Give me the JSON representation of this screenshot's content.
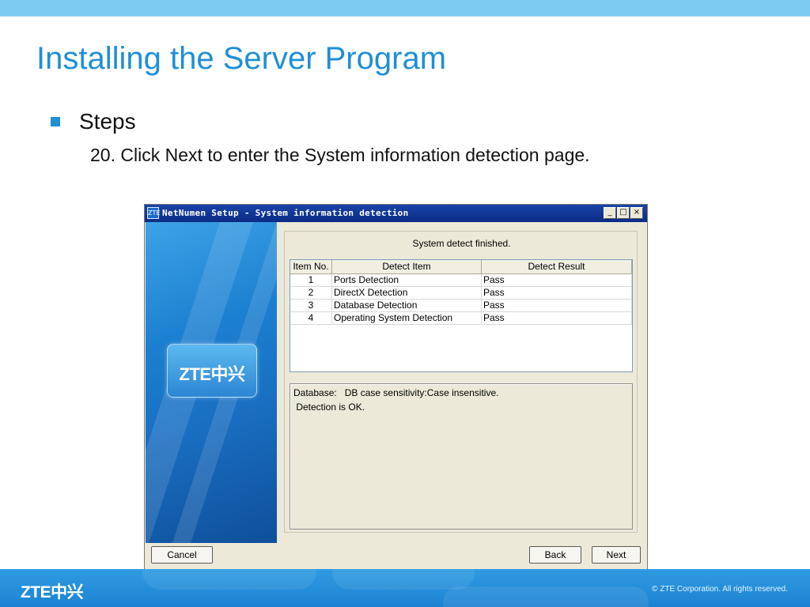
{
  "slide": {
    "title": "Installing the Server Program",
    "bullet": "Steps",
    "step": "20. Click Next to enter the System information detection page."
  },
  "window": {
    "title": "NetNumen Setup - System information detection",
    "icon_label": "ZTE",
    "controls": {
      "minimize": "_",
      "maximize": "□",
      "close": "×"
    },
    "logo_text": "ZTE中兴",
    "status": "System detect finished.",
    "table": {
      "columns": [
        "Item No.",
        "Detect Item",
        "Detect Result"
      ],
      "rows": [
        [
          "1",
          "Ports Detection",
          "Pass"
        ],
        [
          "2",
          "DirectX Detection",
          "Pass"
        ],
        [
          "3",
          "Database Detection",
          "Pass"
        ],
        [
          "4",
          "Operating System Detection",
          "Pass"
        ]
      ]
    },
    "info": {
      "line1": "Database:   DB case sensitivity:Case insensitive.",
      "line2": " Detection is OK."
    },
    "buttons": {
      "cancel": "Cancel",
      "back": "Back",
      "next": "Next"
    }
  },
  "footer": {
    "logo": "ZTE中兴",
    "copyright": "© ZTE Corporation. All rights reserved."
  },
  "colors": {
    "accent": "#1f8fd6",
    "titlebar": "#0b2b86",
    "top_band": "#7ecbf2",
    "footer": "#1c83d2"
  },
  "icons": [
    "window-app-icon",
    "minimize-icon",
    "maximize-icon",
    "close-icon",
    "square-bullet-icon"
  ]
}
